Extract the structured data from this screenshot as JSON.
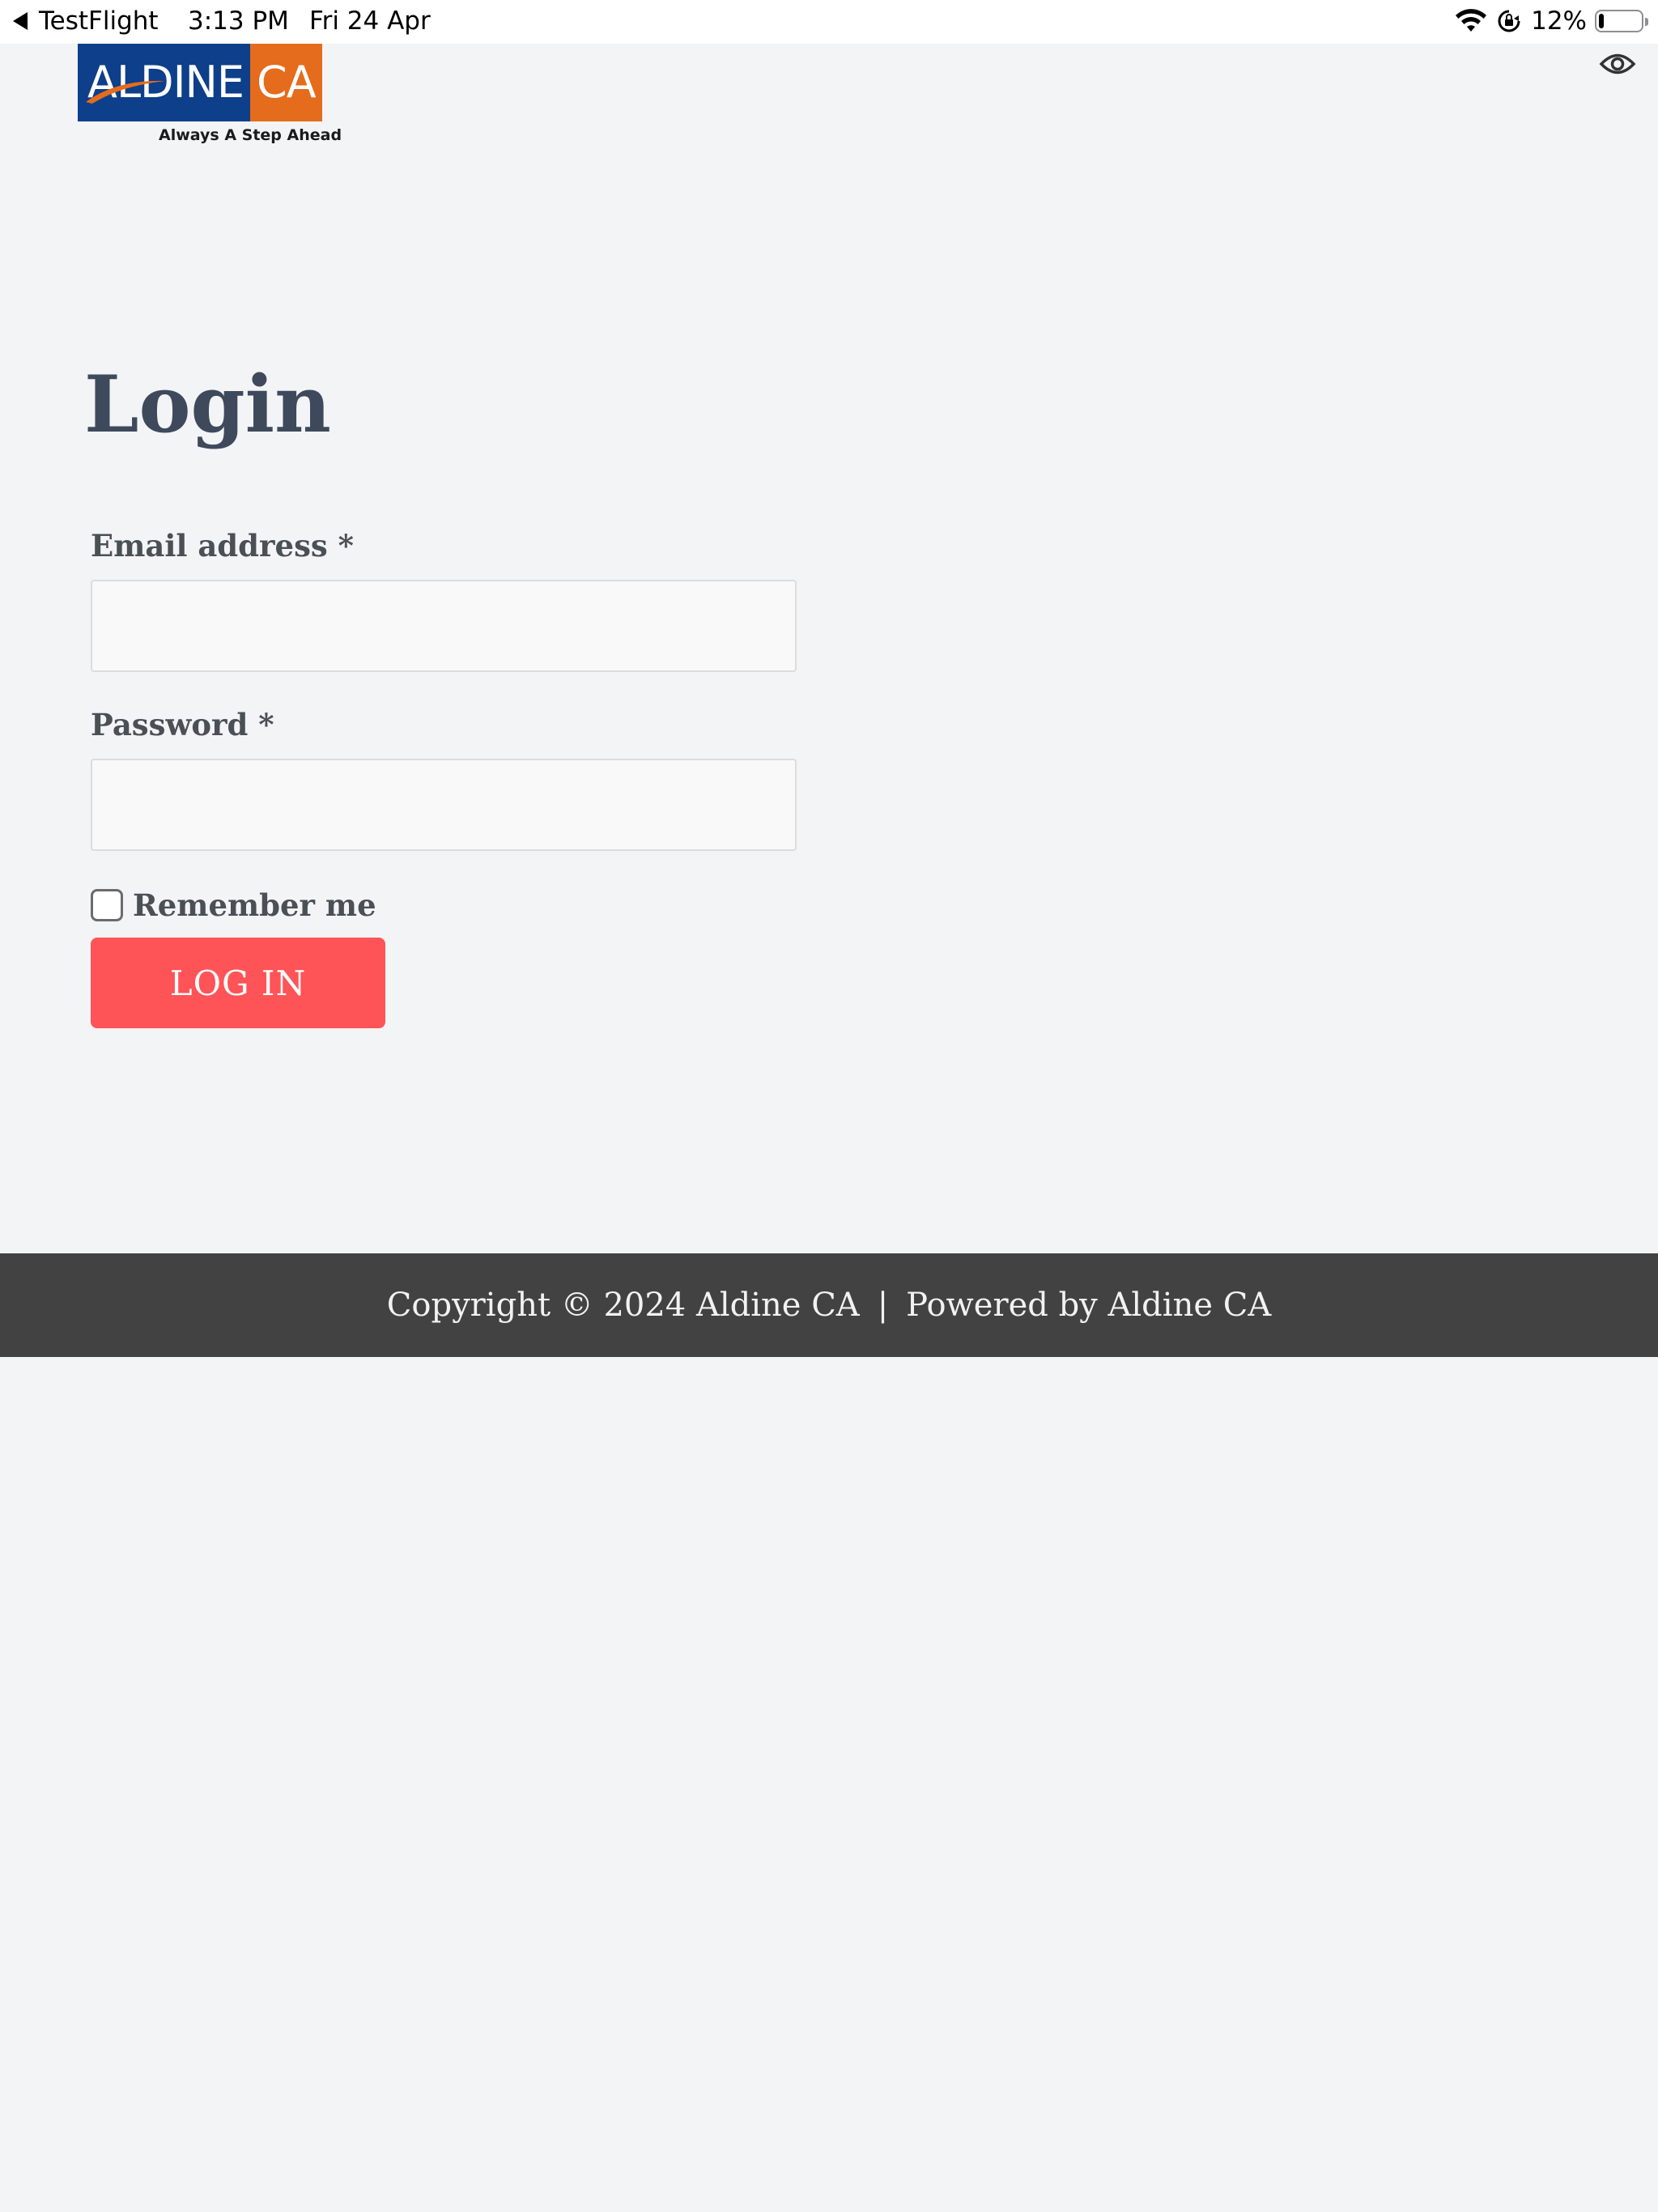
{
  "status_bar": {
    "back_app": "TestFlight",
    "time": "3:13 PM",
    "date": "Fri 24 Apr",
    "battery_percent": "12%",
    "battery_level": 0.12,
    "icons": [
      "back-arrow-icon",
      "wifi-icon",
      "lock-rotation-icon",
      "battery-icon"
    ]
  },
  "header": {
    "logo": {
      "text_left": "ALDINE",
      "text_right": "CA",
      "tagline": "Always A Step Ahead",
      "colors": {
        "blue": "#0d3f8a",
        "orange": "#e56c1c"
      }
    },
    "accessibility_icon": "eye-icon"
  },
  "login_form": {
    "title": "Login",
    "email": {
      "label": "Email address *",
      "value": "",
      "placeholder": ""
    },
    "password": {
      "label": "Password *",
      "value": "",
      "placeholder": ""
    },
    "remember_me": {
      "label": "Remember me",
      "checked": false
    },
    "submit_label": "LOG IN",
    "button_color": "#fe5457"
  },
  "footer": {
    "copyright": "Copyright © 2024 Aldine CA",
    "separator": "|",
    "powered_by": "Powered by Aldine CA",
    "background_color": "#424242"
  }
}
